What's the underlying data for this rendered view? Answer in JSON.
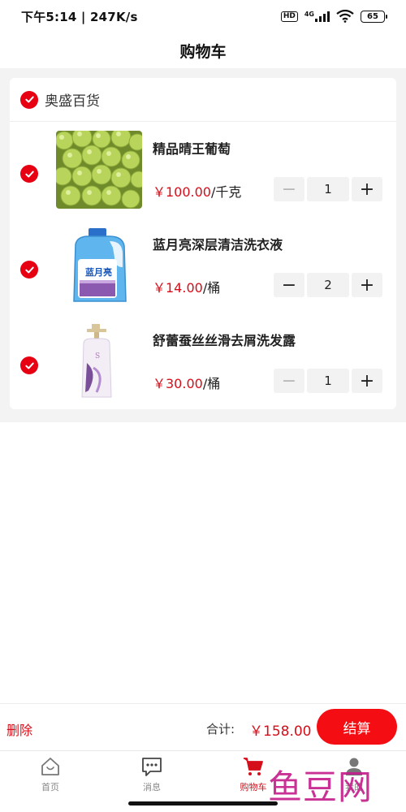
{
  "status_bar": {
    "time_speed": "下午5:14 | 247K/s",
    "hd": "HD",
    "network": "4G",
    "battery": "65"
  },
  "header": {
    "title": "购物车"
  },
  "shop": {
    "name": "奥盛百货",
    "checked": true
  },
  "items": [
    {
      "name": "精品晴王葡萄",
      "price": "￥100.00",
      "unit": "/千克",
      "quantity": "1",
      "minus_disabled": true,
      "image": "green-grapes"
    },
    {
      "name": "蓝月亮深层清洁洗衣液",
      "price": "￥14.00",
      "unit": "/桶",
      "quantity": "2",
      "minus_disabled": false,
      "image": "detergent-bottle"
    },
    {
      "name": "舒蕾蚕丝丝滑去屑洗发露",
      "price": "￥30.00",
      "unit": "/桶",
      "quantity": "1",
      "minus_disabled": true,
      "image": "shampoo-bottle"
    }
  ],
  "detergent_label": "蓝月亮",
  "stepper": {
    "minus": "−",
    "plus": "+"
  },
  "action_bar": {
    "delete_label": "删除",
    "total_label": "合计:",
    "total_value": "￥158.00",
    "checkout_label": "结算"
  },
  "tabs": [
    {
      "label": "首页",
      "icon": "home-icon",
      "active": false
    },
    {
      "label": "消息",
      "icon": "message-icon",
      "active": false
    },
    {
      "label": "购物车",
      "icon": "cart-icon",
      "active": true
    },
    {
      "label": "我的",
      "icon": "user-icon",
      "active": false
    }
  ],
  "watermark": "鱼豆网",
  "colors": {
    "accent": "#e60012",
    "price": "#d40f1a",
    "background": "#f3f3f3"
  }
}
